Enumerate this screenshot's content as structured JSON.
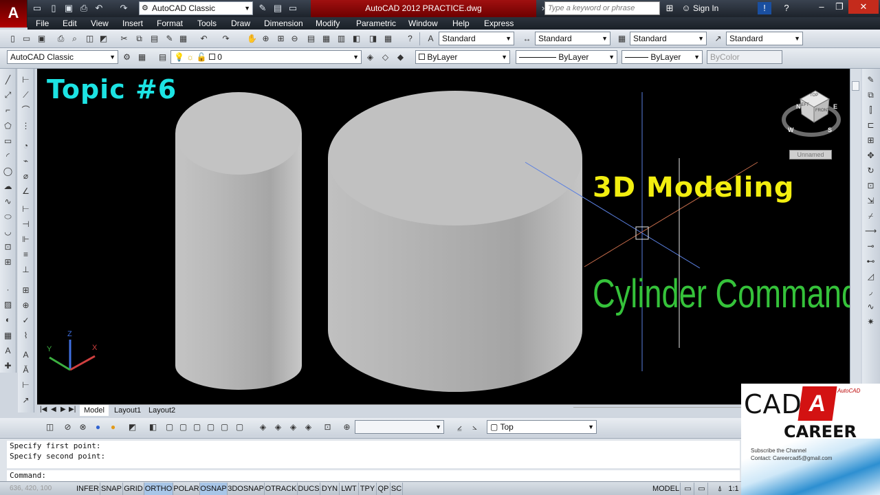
{
  "window": {
    "app_logo_letter": "A",
    "title": "AutoCAD 2012   PRACTICE.dwg",
    "workspace": "AutoCAD Classic",
    "search_placeholder": "Type a keyword or phrase",
    "sign_in": "Sign In"
  },
  "menu": [
    "File",
    "Edit",
    "View",
    "Insert",
    "Format",
    "Tools",
    "Draw",
    "Dimension",
    "Modify",
    "Parametric",
    "Window",
    "Help",
    "Express"
  ],
  "styles_toolbar": {
    "text_style": "Standard",
    "dim_style": "Standard",
    "table_style": "Standard",
    "mleader_style": "Standard"
  },
  "layers_toolbar": {
    "workspace": "AutoCAD Classic",
    "layer": "0",
    "color": "ByLayer",
    "linetype": "ByLayer",
    "lineweight": "ByLayer",
    "plotstyle": "ByColor"
  },
  "canvas": {
    "topic_label": "Topic #6",
    "modeling_label": "3D Modeling",
    "command_label": "Cylinder Command",
    "viewcube_label": "Unnamed",
    "viewcube_faces": [
      "TOP",
      "LEFT",
      "FRONT"
    ],
    "compass": [
      "N",
      "W",
      "S",
      "E"
    ],
    "ucs_axes": [
      "Z",
      "X",
      "Y"
    ]
  },
  "tabs": [
    "Model",
    "Layout1",
    "Layout2"
  ],
  "view_toolbar": {
    "view_name": "Top"
  },
  "command_window": {
    "history": [
      "Specify first point:",
      "Specify second point:"
    ],
    "prompt": "Command:"
  },
  "status": {
    "coordinates": "636, 420, 100",
    "buttons": [
      "INFER",
      "SNAP",
      "GRID",
      "ORTHO",
      "POLAR",
      "OSNAP",
      "3DOSNAP",
      "OTRACK",
      "DUCS",
      "DYN",
      "LWT",
      "TPY",
      "QP",
      "SC"
    ],
    "active_buttons": [
      "ORTHO",
      "OSNAP"
    ],
    "model_label": "MODEL",
    "scale": "1:1"
  },
  "logo": {
    "cad": "CAD",
    "career": "CAREER",
    "brand": "AutoCAD",
    "subscribe": "Subscribe the Channel",
    "contact": "Contact: Careercad5@gmail.com"
  },
  "colors": {
    "topic": "#1ce3e3",
    "modeling": "#f2ee10",
    "command": "#35c23a",
    "canvas_bg": "#000000"
  }
}
